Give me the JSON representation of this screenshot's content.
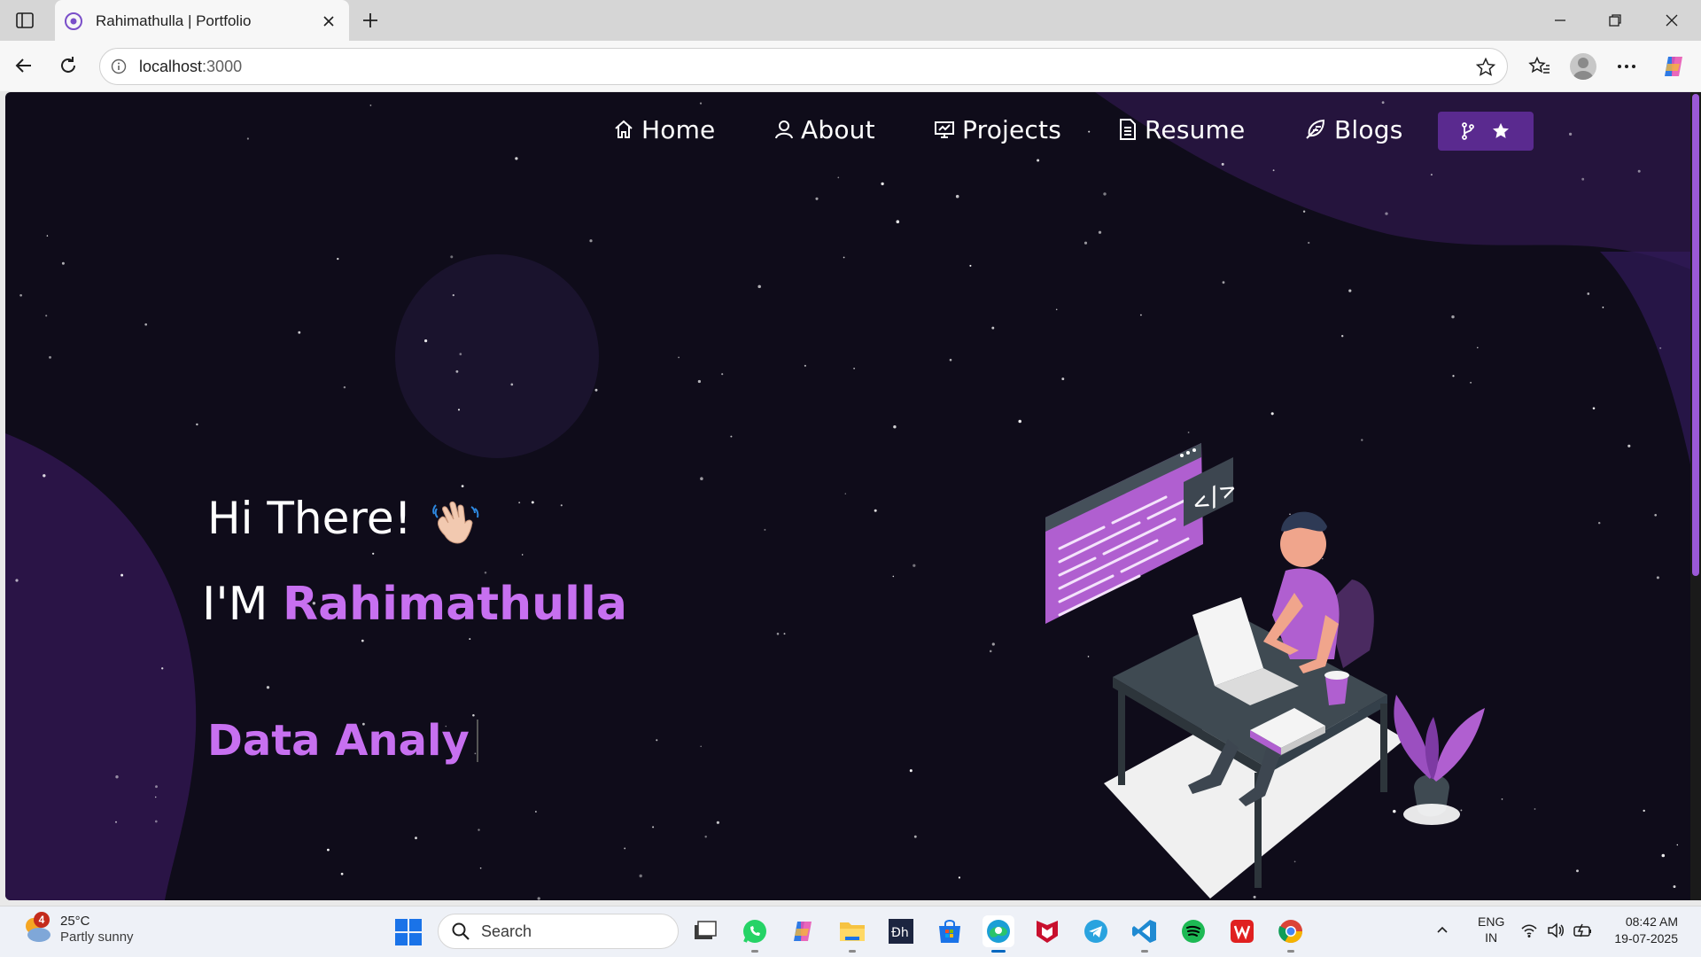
{
  "browser": {
    "tab_title": "Rahimathulla | Portfolio",
    "url_host": "localhost",
    "url_port": ":3000"
  },
  "navbar": {
    "items": [
      {
        "label": "Home",
        "icon": "home-icon"
      },
      {
        "label": "About",
        "icon": "user-icon"
      },
      {
        "label": "Projects",
        "icon": "projects-icon"
      },
      {
        "label": "Resume",
        "icon": "document-icon"
      },
      {
        "label": "Blogs",
        "icon": "feather-icon"
      }
    ],
    "github_button_icons": [
      "git-fork-icon",
      "star-icon"
    ]
  },
  "hero": {
    "greeting": "Hi There!",
    "intro_prefix": "I'M ",
    "name": "Rahimathulla",
    "typed_text": "Data Analy"
  },
  "colors": {
    "accent": "#c770f0",
    "background": "#0f0c1a",
    "button": "#5a2a8f"
  },
  "taskbar": {
    "weather_badge": "4",
    "weather_temp": "25°C",
    "weather_desc": "Partly sunny",
    "search_placeholder": "Search",
    "lang_top": "ENG",
    "lang_bottom": "IN",
    "time": "08:42 AM",
    "date": "19-07-2025"
  }
}
